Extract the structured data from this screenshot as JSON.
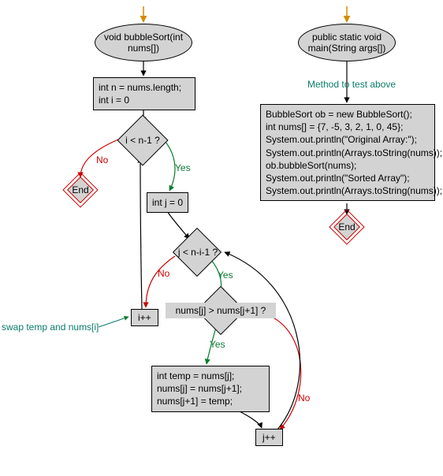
{
  "left": {
    "start": "void bubbleSort(int nums[])",
    "init": "int n = nums.length;\nint i = 0",
    "dec_i": "i < n-1 ?",
    "init_j": "int j = 0",
    "dec_j": "j < n-i-1 ?",
    "dec_swap": "nums[j] > nums[j+1] ?",
    "swap": "int temp = nums[j];\nnums[j] = nums[j+1];\nnums[j+1] = temp;",
    "inc_i": "i++",
    "inc_j": "j++",
    "end": "End",
    "swap_note": "swap temp and nums[i]"
  },
  "right": {
    "start": "public static void main(String args[])",
    "method_note": "Method to test above",
    "body": "BubbleSort ob = new BubbleSort();\nint nums[] = {7, -5, 3, 2, 1, 0, 45};\nSystem.out.println(\"Original Array:\");\nSystem.out.println(Arrays.toString(nums));\nob.bubbleSort(nums);\nSystem.out.println(\"Sorted Array\");\nSystem.out.println(Arrays.toString(nums));",
    "end": "End"
  },
  "labels": {
    "yes": "Yes",
    "no": "No"
  }
}
